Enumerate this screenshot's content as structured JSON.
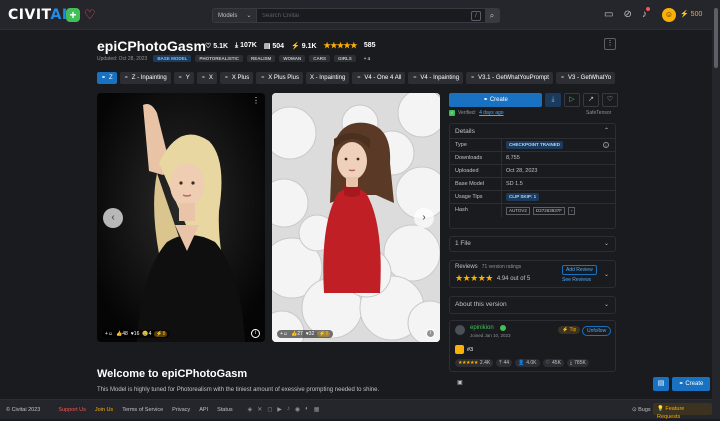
{
  "header": {
    "logo_a": "CIVIT",
    "logo_b": "AI",
    "search_scope": "Models",
    "search_placeholder": "Search Civitai",
    "slash_key": "/",
    "buzz": "500"
  },
  "model": {
    "title": "epiCPhotoGasm",
    "likes": "5.1K",
    "downloads": "107K",
    "comments": "504",
    "buzz": "9.1K",
    "stars": "★★★★★",
    "rating_count": "585",
    "updated": "Updated: Oct 28, 2023",
    "tags": [
      "BASE MODEL",
      "PHOTOREALISTIC",
      "REALISM",
      "WOMAN",
      "CARS",
      "GIRLS",
      "+ 4"
    ]
  },
  "versions": [
    "Z",
    "Z - Inpainting",
    "Y",
    "X",
    "X Plus",
    "X Plus Plus",
    "X - Inpainting",
    "V4 - One 4 All",
    "V4 - Inpainting",
    "V3.1 - GetWhatYouPrompt",
    "V3 - GetWhatYo"
  ],
  "images": [
    {
      "reactions": [
        "48",
        "16",
        "4",
        "8"
      ],
      "cry": "😢"
    },
    {
      "reactions": [
        "27",
        "32",
        "8"
      ]
    }
  ],
  "content": {
    "welcome": "Welcome to epiCPhotoGasm",
    "description": "This Model is highly tuned for Photorealism with the tiniest amount of exessive prompting needed to shine."
  },
  "actions": {
    "create": "Create",
    "verified": "Verified:",
    "verified_ago": "4 days ago",
    "safetensor": "SafeTensor"
  },
  "details": {
    "title": "Details",
    "rows": [
      {
        "k": "Type",
        "v": "CHECKPOINT TRAINED"
      },
      {
        "k": "Downloads",
        "v": "8,755"
      },
      {
        "k": "Uploaded",
        "v": "Oct 28, 2023"
      },
      {
        "k": "Base Model",
        "v": "SD 1.5"
      },
      {
        "k": "Usage Tips",
        "v": "CLIP SKIP: 1"
      },
      {
        "k": "Hash",
        "v": "AUTOV2",
        "v2": "D37263937F"
      }
    ]
  },
  "files": {
    "title": "1 File"
  },
  "reviews": {
    "title": "Reviews",
    "count": "71 version ratings",
    "stars": "★★★★★",
    "score": "4.94 out of 5",
    "add": "Add Review",
    "see": "See Reviews"
  },
  "about": {
    "title": "About this version"
  },
  "creator": {
    "name": "epinikion",
    "joined": "Joined Jan 10, 2023",
    "tip": "Tip",
    "unfollow": "Unfollow",
    "rank": "#3",
    "stars": "★★★★★",
    "reviews": "2.4K",
    "uploads": "44",
    "followers": "4.0K",
    "likes": "45K",
    "downloads": "785K"
  },
  "float": {
    "create": "Create"
  },
  "footer": {
    "copyright": "© Civitai 2023",
    "support": "Support Us",
    "join": "Join Us",
    "tos": "Terms of Service",
    "privacy": "Privacy",
    "api": "API",
    "status": "Status",
    "bugs": "Bugs",
    "features": "Feature Requests"
  },
  "colors": {
    "accent": "#1971c2",
    "star": "#fab005",
    "success": "#40c057",
    "danger": "#fa5252"
  }
}
